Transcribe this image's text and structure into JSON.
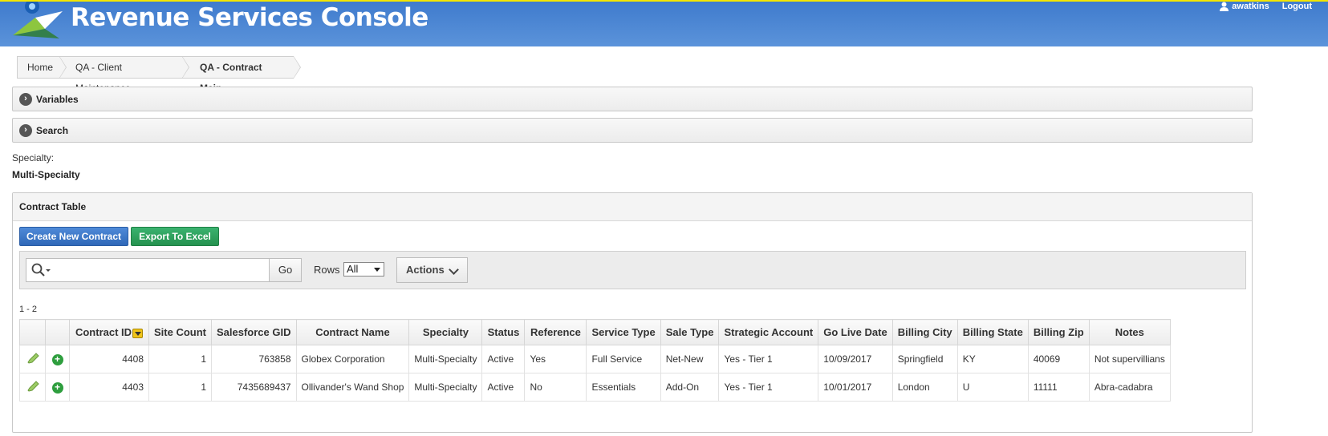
{
  "header": {
    "title": "Revenue Services Console",
    "username": "awatkins",
    "logout_label": "Logout",
    "accent_color": "#4a86d4",
    "top_border_color": "#f4e600"
  },
  "breadcrumb": {
    "items": [
      "Home",
      "QA - Client Maintenance",
      "QA - Contract Main"
    ]
  },
  "regions": {
    "variables_label": "Variables",
    "search_label": "Search"
  },
  "specialty": {
    "label": "Specialty:",
    "value": "Multi-Specialty"
  },
  "contract_table": {
    "title": "Contract Table",
    "create_button": "Create New Contract",
    "export_button": "Export To Excel",
    "search_value": "",
    "go_label": "Go",
    "rows_label": "Rows",
    "rows_value": "All",
    "actions_label": "Actions",
    "pagination": "1 - 2",
    "columns": [
      "Contract ID",
      "Site Count",
      "Salesforce GID",
      "Contract Name",
      "Specialty",
      "Status",
      "Reference",
      "Service Type",
      "Sale Type",
      "Strategic Account",
      "Go Live Date",
      "Billing City",
      "Billing State",
      "Billing Zip",
      "Notes"
    ],
    "rows": [
      [
        "4408",
        "1",
        "763858",
        "Globex Corporation",
        "Multi-Specialty",
        "Active",
        "Yes",
        "Full Service",
        "Net-New",
        "Yes - Tier 1",
        "10/09/2017",
        "Springfield",
        "KY",
        "40069",
        "Not supervillians"
      ],
      [
        "4403",
        "1",
        "7435689437",
        "Ollivander's Wand Shop",
        "Multi-Specialty",
        "Active",
        "No",
        "Essentials",
        "Add-On",
        "Yes - Tier 1",
        "10/01/2017",
        "London",
        "U",
        "11111",
        "Abra-cadabra"
      ]
    ]
  }
}
